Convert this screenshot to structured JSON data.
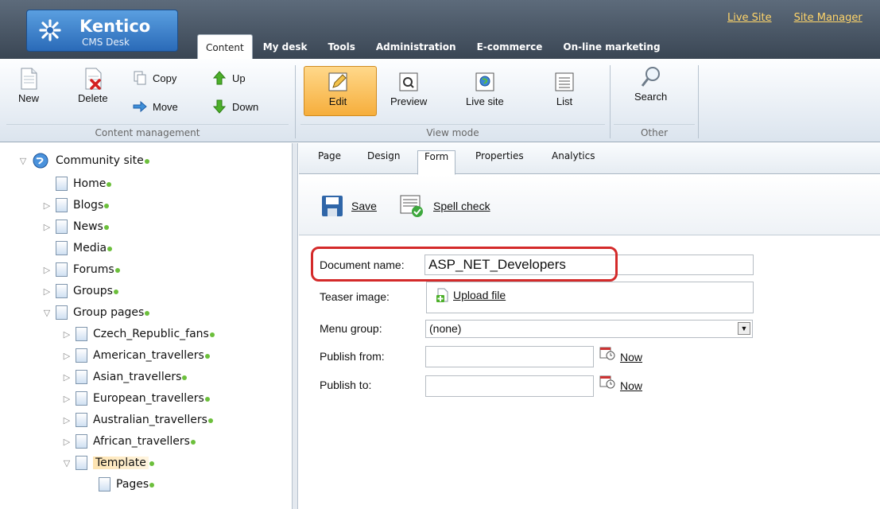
{
  "app": {
    "brand": "Kentico",
    "subtitle": "CMS Desk"
  },
  "top_tabs": [
    "Content",
    "My desk",
    "Tools",
    "Administration",
    "E-commerce",
    "On-line marketing"
  ],
  "top_links": [
    "Live Site",
    "Site Manager"
  ],
  "ribbon": {
    "content_management": {
      "label": "Content management",
      "new": "New",
      "delete": "Delete",
      "copy": "Copy",
      "move": "Move",
      "up": "Up",
      "down": "Down"
    },
    "view_mode": {
      "label": "View mode",
      "edit": "Edit",
      "preview": "Preview",
      "live_site": "Live site",
      "list": "List"
    },
    "other": {
      "label": "Other",
      "search": "Search"
    }
  },
  "tree": [
    {
      "label": "Community site",
      "level": 0,
      "expanded": true,
      "icon": "globe-icon"
    },
    {
      "label": "Home",
      "level": 1
    },
    {
      "label": "Blogs",
      "level": 1,
      "collapsed": true
    },
    {
      "label": "News",
      "level": 1,
      "collapsed": true
    },
    {
      "label": "Media",
      "level": 1
    },
    {
      "label": "Forums",
      "level": 1,
      "collapsed": true
    },
    {
      "label": "Groups",
      "level": 1,
      "collapsed": true
    },
    {
      "label": "Group pages",
      "level": 1,
      "expanded": true
    },
    {
      "label": "Czech_Republic_fans",
      "level": 2,
      "collapsed": true
    },
    {
      "label": "American_travellers",
      "level": 2,
      "collapsed": true
    },
    {
      "label": "Asian_travellers",
      "level": 2,
      "collapsed": true
    },
    {
      "label": "European_travellers",
      "level": 2,
      "collapsed": true
    },
    {
      "label": "Australian_travellers",
      "level": 2,
      "collapsed": true
    },
    {
      "label": "African_travellers",
      "level": 2,
      "collapsed": true
    },
    {
      "label": "Template",
      "level": 2,
      "expanded": true,
      "selected": true
    },
    {
      "label": "Pages",
      "level": 3
    }
  ],
  "sub_tabs": [
    "Page",
    "Design",
    "Form",
    "Properties",
    "Analytics"
  ],
  "actions": {
    "save": "Save",
    "spell_check": "Spell check"
  },
  "form": {
    "document_name_label": "Document name:",
    "document_name_value": "ASP_NET_Developers",
    "teaser_image_label": "Teaser image:",
    "upload_file": "Upload file",
    "menu_group_label": "Menu group:",
    "menu_group_value": "(none)",
    "publish_from_label": "Publish from:",
    "publish_to_label": "Publish to:",
    "now": "Now"
  },
  "colors": {
    "accent": "#f6ae3c",
    "highlight": "#d42a2a",
    "published_dot": "#6cbf3c"
  }
}
